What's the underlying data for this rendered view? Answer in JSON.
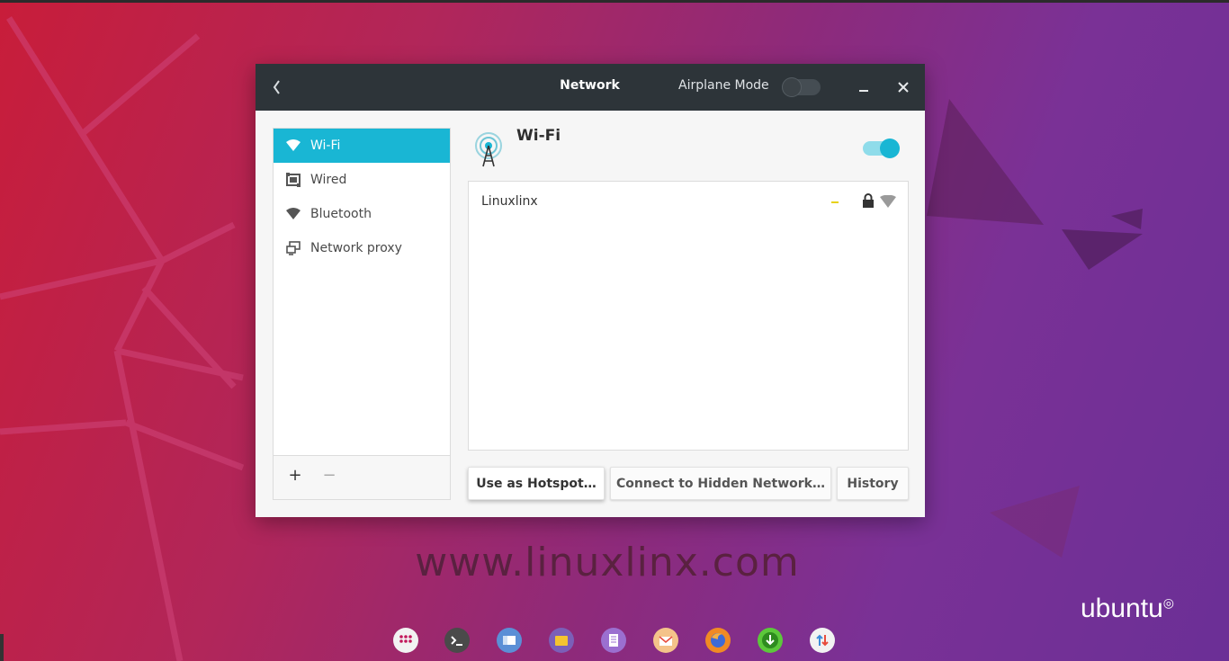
{
  "window": {
    "title": "Network",
    "airplane_mode_label": "Airplane Mode",
    "airplane_mode_on": false
  },
  "sidebar": {
    "items": [
      {
        "label": "Wi-Fi",
        "icon": "wifi-icon",
        "active": true
      },
      {
        "label": "Wired",
        "icon": "ethernet-icon",
        "active": false
      },
      {
        "label": "Bluetooth",
        "icon": "bluetooth-icon",
        "active": false
      },
      {
        "label": "Network proxy",
        "icon": "proxy-icon",
        "active": false
      }
    ],
    "add_label": "+",
    "remove_label": "−"
  },
  "main": {
    "title": "Wi-Fi",
    "wifi_enabled": true,
    "networks": [
      {
        "name": "Linuxlinx",
        "secured": true,
        "connected": true
      }
    ],
    "buttons": {
      "hotspot": "Use as Hotspot…",
      "hidden": "Connect to Hidden Network…",
      "history": "History"
    }
  },
  "desktop": {
    "watermark": "www.linuxlinx.com",
    "brand": "ubuntu"
  },
  "colors": {
    "accent": "#19b6d4",
    "titlebar": "#2d3439"
  },
  "dock": {
    "apps": [
      "apps-grid-icon",
      "terminal-icon",
      "files-icon",
      "folder-icon",
      "text-editor-icon",
      "mail-icon",
      "firefox-icon",
      "download-icon",
      "updates-icon"
    ]
  }
}
